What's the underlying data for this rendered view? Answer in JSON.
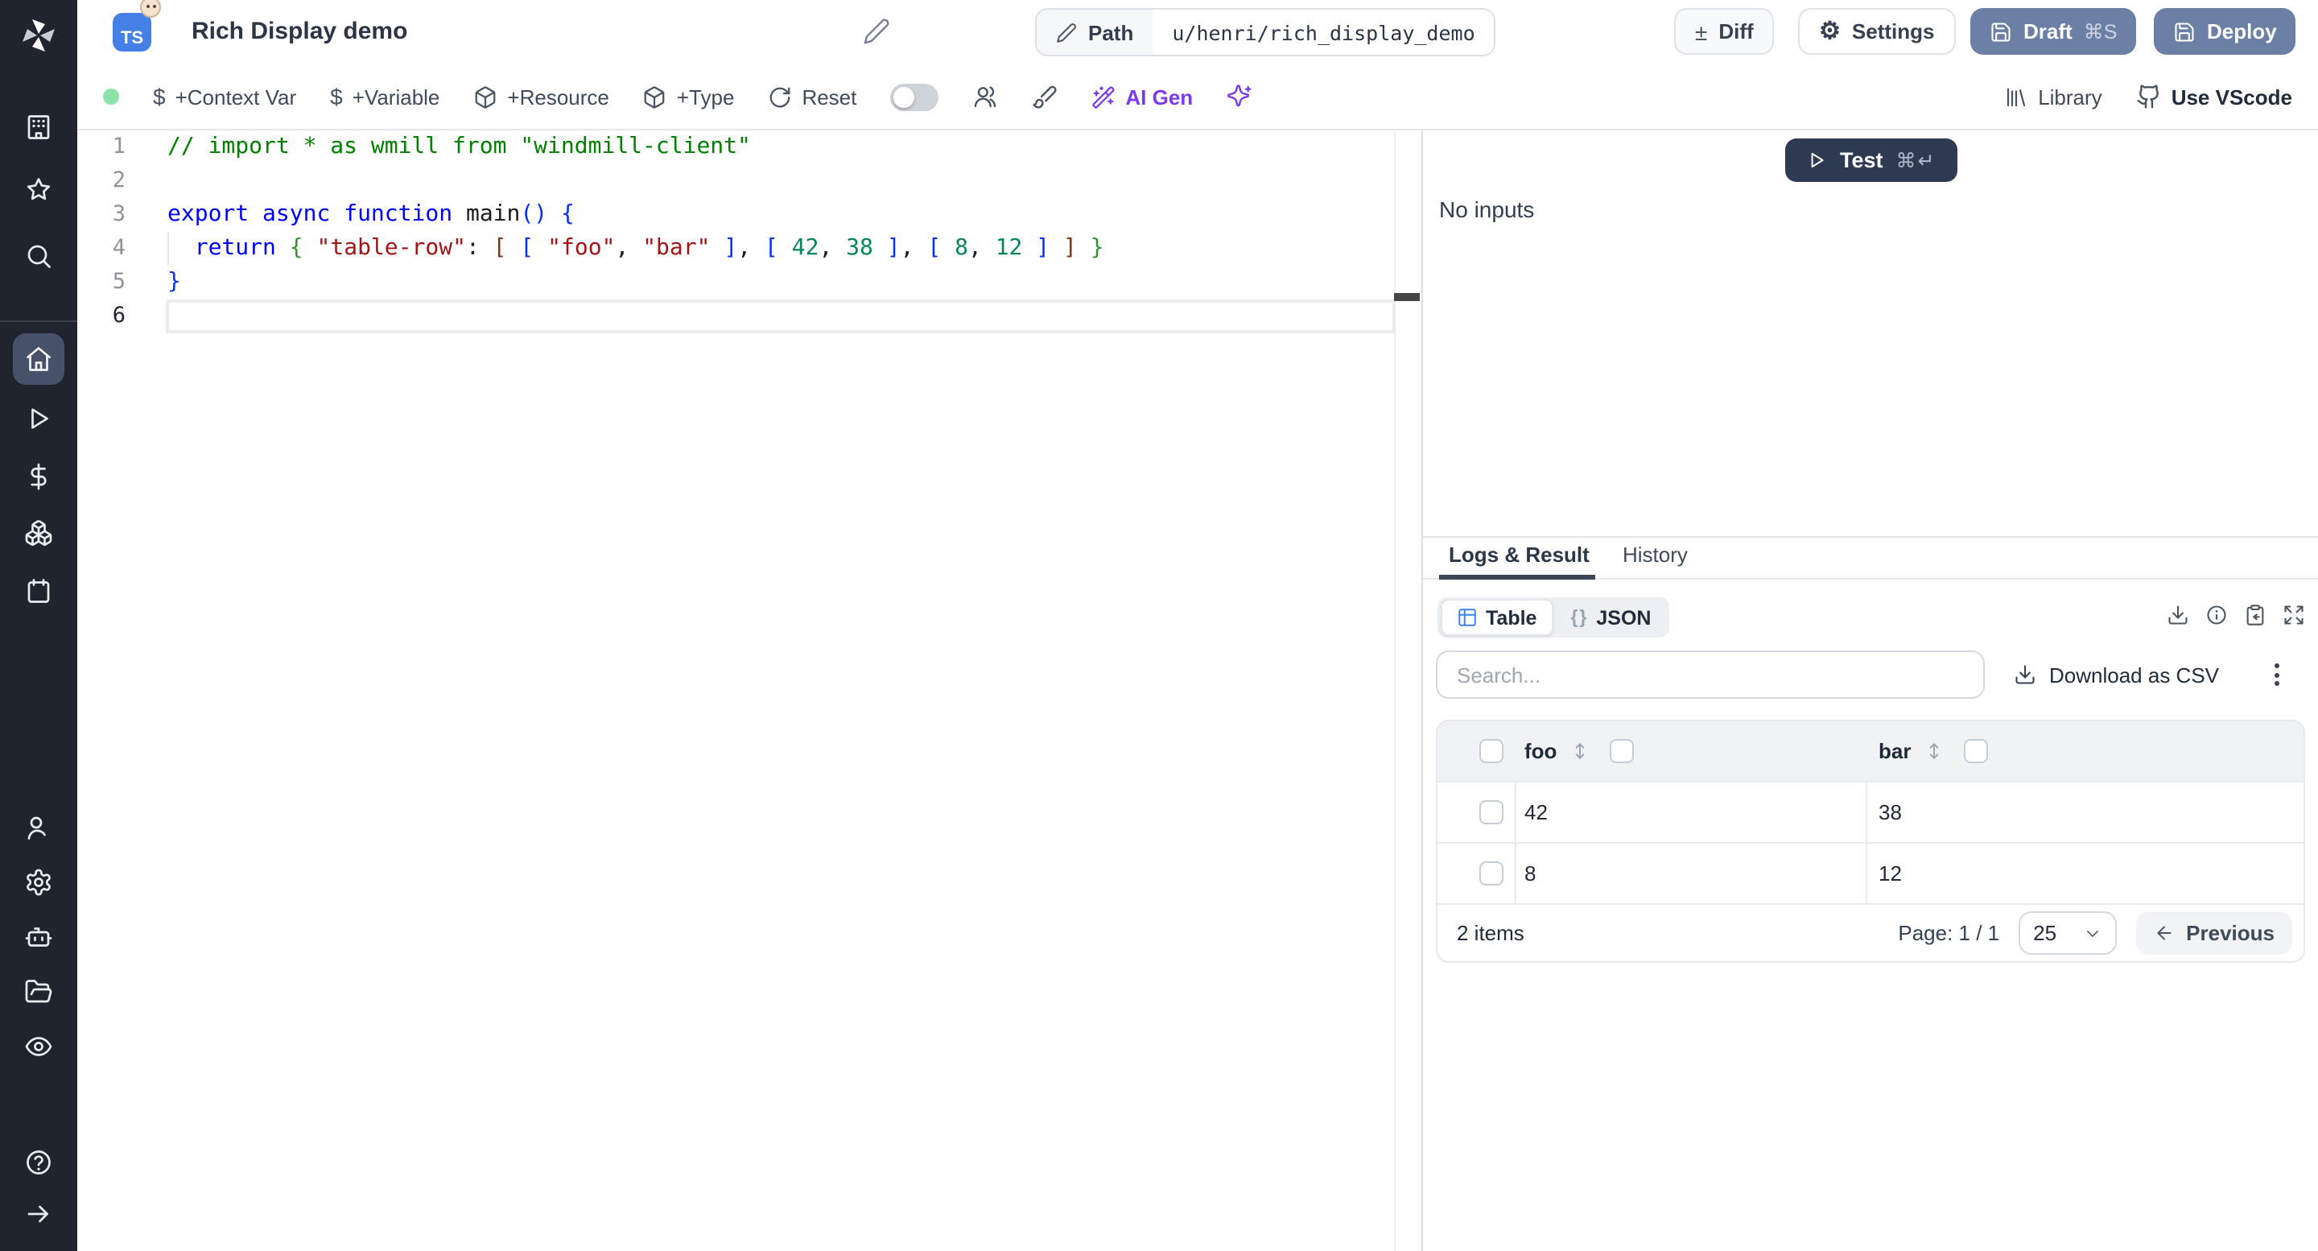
{
  "colors": {
    "sidebar_bg": "#20242e",
    "active_nav_bg": "#475169",
    "primary_button": "#6b80a4",
    "test_button": "#2e3a52",
    "ai_purple": "#7c3aed",
    "status_green": "#8be3a8",
    "table_icon_blue": "#3b82f6",
    "ts_badge_blue": "#4580e6"
  },
  "header": {
    "badge": "TS",
    "badge_emoji": "👶",
    "title": "Rich Display demo",
    "path_label": "Path",
    "path_value": "u/henri/rich_display_demo",
    "diff": "Diff",
    "diff_glyph": "±",
    "settings": "Settings",
    "settings_glyph": "⚙",
    "draft": "Draft",
    "draft_shortcut": "⌘S",
    "deploy": "Deploy"
  },
  "toolbar": {
    "dollar": "$",
    "context_var": "+Context Var",
    "variable": "+Variable",
    "resource": "+Resource",
    "type": "+Type",
    "reset": "Reset",
    "ai_gen": "AI Gen",
    "library": "Library",
    "use_vscode": "Use VScode"
  },
  "editor": {
    "active_line": 6,
    "colors": {
      "comment": "#008000",
      "keyword": "#0000ff",
      "string": "#a31515",
      "number": "#098658",
      "bracket1": "#0431fa",
      "bracket2": "#319331",
      "bracket3": "#7b3814",
      "plain": "#1b1b1b"
    },
    "lines": [
      {
        "num": "1",
        "tokens": [
          [
            "// import * as wmill from \"windmill-client\"",
            "comment"
          ]
        ]
      },
      {
        "num": "2",
        "tokens": []
      },
      {
        "num": "3",
        "tokens": [
          [
            "export",
            "keyword"
          ],
          [
            " ",
            "plain"
          ],
          [
            "async",
            "keyword"
          ],
          [
            " ",
            "plain"
          ],
          [
            "function",
            "keyword"
          ],
          [
            " ",
            "plain"
          ],
          [
            "main",
            "plain"
          ],
          [
            "()",
            "bracket1"
          ],
          [
            " ",
            "plain"
          ],
          [
            "{",
            "bracket1"
          ]
        ]
      },
      {
        "num": "4",
        "tokens": [
          [
            "  ",
            "plain"
          ],
          [
            "return",
            "keyword"
          ],
          [
            " ",
            "plain"
          ],
          [
            "{",
            "bracket2"
          ],
          [
            " ",
            "plain"
          ],
          [
            "\"table-row\"",
            "string"
          ],
          [
            ": ",
            "plain"
          ],
          [
            "[",
            "bracket3"
          ],
          [
            " ",
            "plain"
          ],
          [
            "[",
            "bracket1"
          ],
          [
            " ",
            "plain"
          ],
          [
            "\"foo\"",
            "string"
          ],
          [
            ", ",
            "plain"
          ],
          [
            "\"bar\"",
            "string"
          ],
          [
            " ",
            "plain"
          ],
          [
            "]",
            "bracket1"
          ],
          [
            ", ",
            "plain"
          ],
          [
            "[",
            "bracket1"
          ],
          [
            " ",
            "plain"
          ],
          [
            "42",
            "number"
          ],
          [
            ", ",
            "plain"
          ],
          [
            "38",
            "number"
          ],
          [
            " ",
            "plain"
          ],
          [
            "]",
            "bracket1"
          ],
          [
            ", ",
            "plain"
          ],
          [
            "[",
            "bracket1"
          ],
          [
            " ",
            "plain"
          ],
          [
            "8",
            "number"
          ],
          [
            ", ",
            "plain"
          ],
          [
            "12",
            "number"
          ],
          [
            " ",
            "plain"
          ],
          [
            "]",
            "bracket1"
          ],
          [
            " ",
            "plain"
          ],
          [
            "]",
            "bracket3"
          ],
          [
            " ",
            "plain"
          ],
          [
            "}",
            "bracket2"
          ]
        ]
      },
      {
        "num": "5",
        "tokens": [
          [
            "}",
            "bracket1"
          ]
        ]
      },
      {
        "num": "6",
        "tokens": []
      }
    ]
  },
  "run_panel": {
    "test_label": "Test",
    "test_shortcut": "⌘↵",
    "no_inputs": "No inputs"
  },
  "result_panel": {
    "tabs": {
      "logs": "Logs & Result",
      "history": "History"
    },
    "view_table": "Table",
    "view_json": "JSON",
    "json_glyph": "{}",
    "search_placeholder": "Search...",
    "download_csv": "Download as CSV",
    "table": {
      "columns": [
        "foo",
        "bar"
      ],
      "rows": [
        [
          "42",
          "38"
        ],
        [
          "8",
          "12"
        ]
      ],
      "items_label": "2 items",
      "page_label": "Page: 1 / 1",
      "page_size": "25",
      "previous": "Previous"
    }
  }
}
